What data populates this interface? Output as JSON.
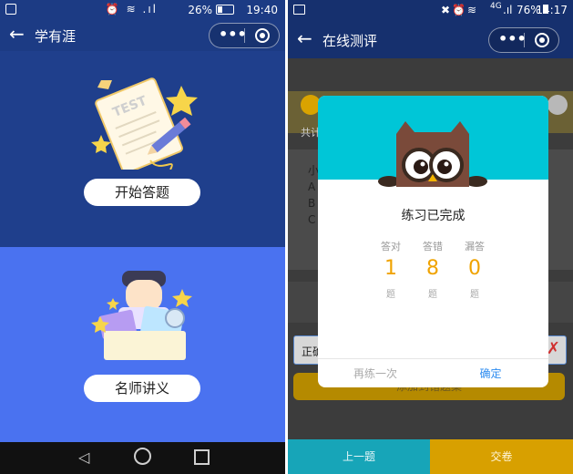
{
  "left": {
    "status": {
      "battery": "26%",
      "time": "19:40"
    },
    "title": "学有涯",
    "start_button": "开始答题",
    "lecture_button": "名师讲义",
    "test_paper_text": "TEST"
  },
  "right": {
    "status": {
      "signal": "4G",
      "battery": "76%",
      "time": "14:17"
    },
    "title": "在线测评",
    "background_text": {
      "count_prefix": "共计",
      "q_prefix": "小",
      "opt_a": "A",
      "opt_b": "B",
      "opt_c": "C",
      "answer_prefix": "正确"
    },
    "modal": {
      "title": "练习已完成",
      "stats": [
        {
          "label": "答对",
          "value": "1",
          "unit": "题"
        },
        {
          "label": "答错",
          "value": "8",
          "unit": "题"
        },
        {
          "label": "漏答",
          "value": "0",
          "unit": "题"
        }
      ],
      "retry": "再练一次",
      "confirm": "确定"
    },
    "add_wrong_button": "添加到错题集",
    "prev_button": "上一题",
    "submit_button": "交卷"
  },
  "colors": {
    "navy": "#1c3b84",
    "blue": "#4a72f0",
    "cyan": "#00c6d7",
    "orange": "#f0a300",
    "confirm_blue": "#2d8cf0",
    "teal": "#17a5b8",
    "gold": "#d8a000"
  }
}
